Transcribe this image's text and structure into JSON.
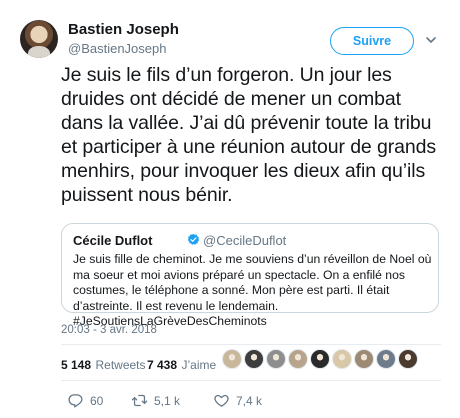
{
  "author": {
    "display_name": "Bastien Joseph",
    "handle": "@BastienJoseph"
  },
  "follow_button": {
    "label": "Suivre"
  },
  "tweet": {
    "text": "Je suis le fils d’un forgeron. Un jour les druides ont décidé de mener un combat dans la vallée. J’ai dû prévenir toute la tribu et participer à une réunion autour de grands menhirs, pour invoquer les dieux afin qu’ils puissent nous bénir.",
    "timestamp": "20:03 - 3 avr. 2018"
  },
  "quoted_tweet": {
    "display_name": "Cécile Duflot",
    "handle": "@CecileDuflot",
    "text": "Je suis fille de cheminot. Je me souviens d’un réveillon de Noel où ma soeur et moi avions préparé un spectacle. On a enfilé nos costumes, le téléphone a sonné. Mon père est parti. Il était d’astreinte. Il est revenu le lendemain. #JeSoutiensLaGrèveDesCheminots"
  },
  "stats": {
    "retweets_count": "5 148",
    "retweets_label": "Retweets",
    "likes_count": "7 438",
    "likes_label": "J’aime"
  },
  "likers": [
    {
      "color": "#c9b79c"
    },
    {
      "color": "#3d3d3d"
    },
    {
      "color": "#8e8e8e"
    },
    {
      "color": "#b8a48c"
    },
    {
      "color": "#2a2a2a"
    },
    {
      "color": "#d8c8a8"
    },
    {
      "color": "#9c8a74"
    },
    {
      "color": "#6d7b8a"
    },
    {
      "color": "#4a3b2e"
    }
  ],
  "actions": {
    "replies": "60",
    "retweets": "5,1 k",
    "likes": "7,4 k"
  },
  "colors": {
    "accent": "#1da1f2",
    "secondary_text": "#657786",
    "border": "#e6ecf0"
  }
}
